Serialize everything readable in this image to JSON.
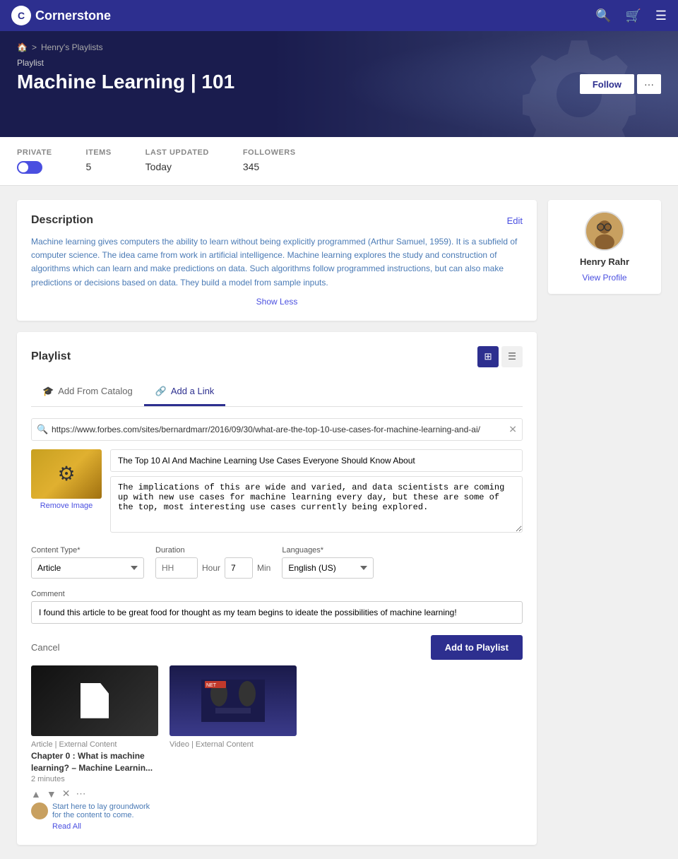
{
  "navbar": {
    "brand": "Cornerstone",
    "search_icon": "🔍",
    "cart_icon": "🛒",
    "menu_icon": "☰"
  },
  "breadcrumb": {
    "home": "🏠",
    "separator": ">",
    "parent": "Henry's Playlists"
  },
  "hero": {
    "label": "Playlist",
    "title": "Machine Learning | 101",
    "follow_label": "Follow",
    "more_label": "···"
  },
  "stats": {
    "private_label": "PRIVATE",
    "items_label": "ITEMS",
    "items_value": "5",
    "last_updated_label": "LAST UPDATED",
    "last_updated_value": "Today",
    "followers_label": "FOLLOWERS",
    "followers_value": "345"
  },
  "description": {
    "title": "Description",
    "edit_label": "Edit",
    "text": "Machine learning gives computers the ability to learn without being explicitly programmed (Arthur Samuel, 1959). It is a subfield of computer science. The idea came from work in artificial intelligence. Machine learning explores the study and construction of algorithms which can learn and make predictions on data. Such algorithms follow programmed instructions, but can also make predictions or decisions based on data. They build a model from sample inputs.",
    "show_less": "Show Less"
  },
  "playlist": {
    "title": "Playlist",
    "tab_catalog": "Add From Catalog",
    "tab_link": "Add a Link",
    "url_placeholder": "https://www.forbes.com/sites/bernardmarr/2016/09/30/what-are-the-top-10-use-cases-for-machine-learning-and-ai/",
    "link_title": "The Top 10 AI And Machine Learning Use Cases Everyone Should Know About",
    "link_description": "The implications of this are wide and varied, and data scientists are coming up with new use cases for machine learning every day, but these are some of the top, most interesting use cases currently being explored.",
    "remove_image": "Remove Image",
    "content_type_label": "Content Type*",
    "content_type_value": "Article",
    "duration_label": "Duration",
    "duration_hh": "HH",
    "duration_hour": "Hour",
    "duration_min_value": "7",
    "duration_min_label": "Min",
    "languages_label": "Languages*",
    "languages_value": "English (US)",
    "comment_label": "Comment",
    "comment_value": "I found this article to be great food for thought as my team begins to ideate the possibilities of machine learning!",
    "cancel_label": "Cancel",
    "add_label": "Add to Playlist"
  },
  "playlist_items": [
    {
      "type": "Article | External Content",
      "title": "Chapter 0 : What is machine learning? – Machine Learnin...",
      "duration": "2 minutes",
      "comment": "Start here to lay groundwork for the content to come.",
      "read_all": "Read All"
    },
    {
      "type": "Video | External Content",
      "title": "",
      "duration": ""
    }
  ],
  "profile": {
    "name": "Henry Rahr",
    "view_profile": "View Profile"
  }
}
